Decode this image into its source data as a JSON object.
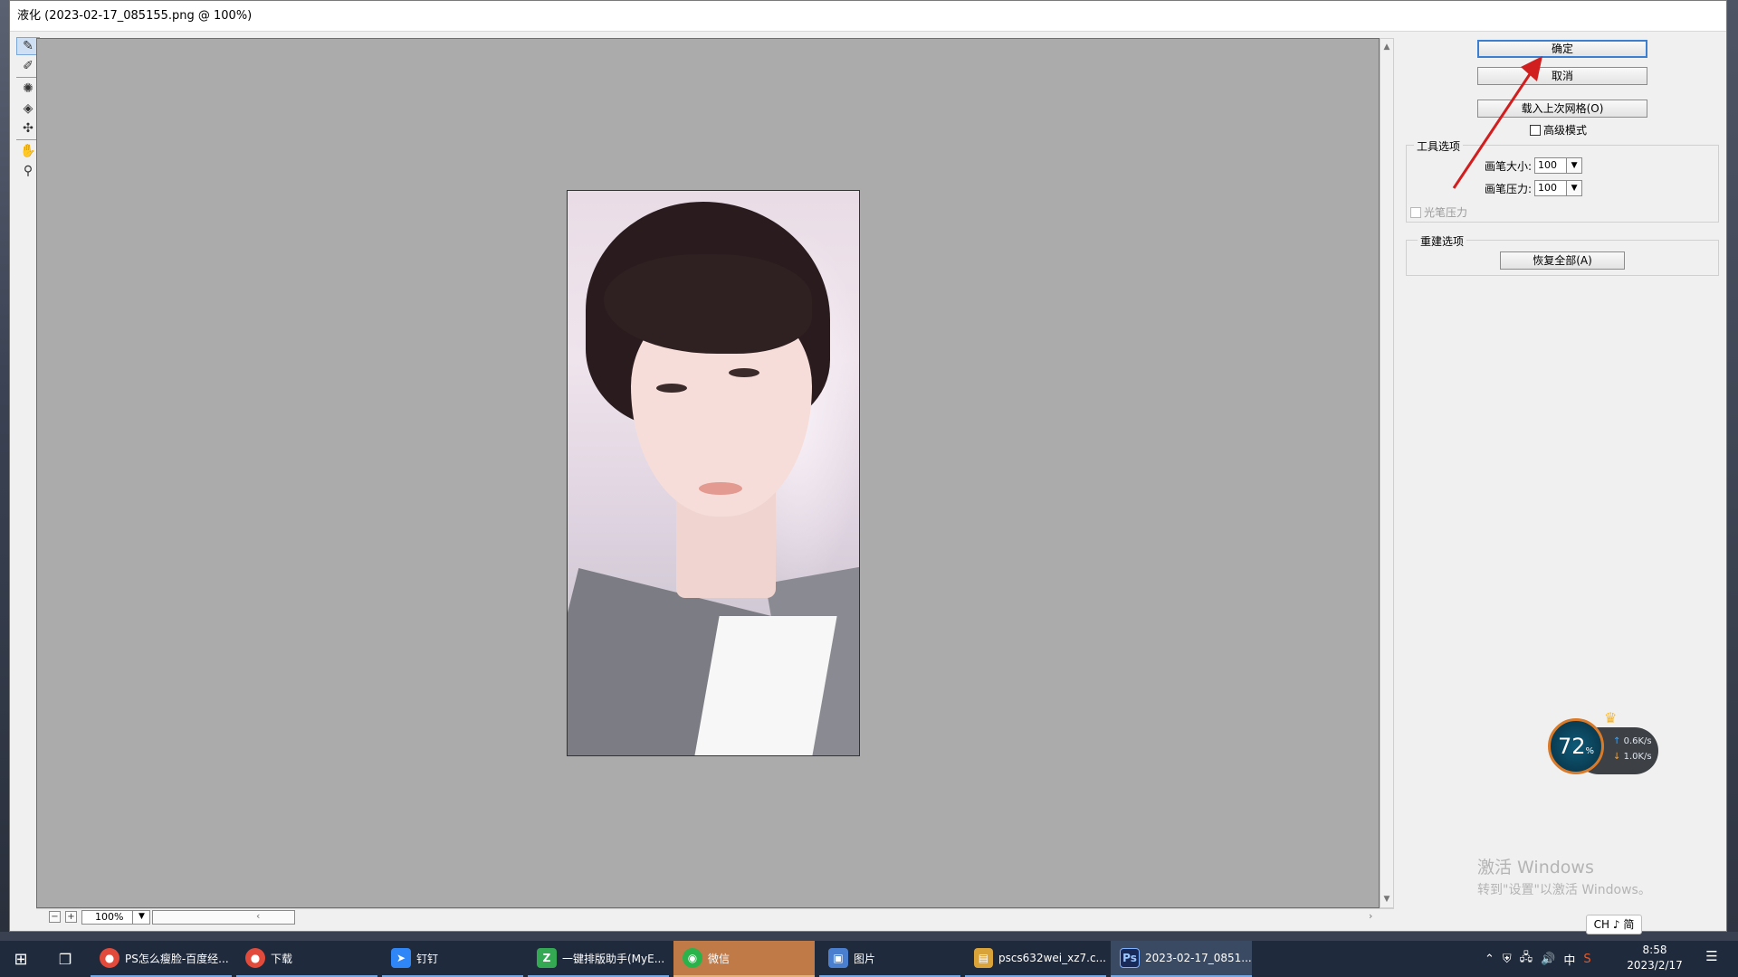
{
  "window": {
    "title": "液化 (2023-02-17_085155.png @ 100%)"
  },
  "tools": [
    {
      "name": "forward-warp-tool",
      "glyph": "✎"
    },
    {
      "name": "reconstruct-tool",
      "glyph": "✐"
    },
    {
      "name": "twirl-tool",
      "glyph": "✺"
    },
    {
      "name": "pucker-tool",
      "glyph": "◈"
    },
    {
      "name": "bloat-tool",
      "glyph": "✣"
    },
    {
      "name": "hand-tool",
      "glyph": "✋"
    },
    {
      "name": "zoom-tool",
      "glyph": "⚲"
    }
  ],
  "canvas": {
    "zoom_value": "100%"
  },
  "panel": {
    "ok_label": "确定",
    "cancel_label": "取消",
    "load_mesh_label": "载入上次网格(O)",
    "advanced_mode_label": "高级模式",
    "tool_options_title": "工具选项",
    "brush_size_label": "画笔大小:",
    "brush_size_value": "100",
    "brush_pressure_label": "画笔压力:",
    "brush_pressure_value": "100",
    "stylus_pressure_label": "光笔压力",
    "reconstruct_title": "重建选项",
    "restore_all_label": "恢复全部(A)"
  },
  "net_widget": {
    "percent": "72",
    "percent_unit": "%",
    "up_speed": "0.6K/s",
    "down_speed": "1.0K/s"
  },
  "watermark": {
    "line1": "激活 Windows",
    "line2": "转到\"设置\"以激活 Windows。"
  },
  "ime_indicator": "CH ♪ 简",
  "taskbar": {
    "items": [
      {
        "label": "PS怎么瘦脸-百度经...",
        "icon_name": "chrome-icon",
        "icon_color": "#e24b3b"
      },
      {
        "label": "下载",
        "icon_name": "chrome-icon",
        "icon_color": "#e24b3b"
      },
      {
        "label": "钉钉",
        "icon_name": "dingtalk-icon",
        "icon_color": "#2f86f6"
      },
      {
        "label": "一键排版助手(MyE...",
        "icon_name": "myeditor-icon",
        "icon_color": "#34a853"
      },
      {
        "label": "微信",
        "icon_name": "wechat-icon",
        "icon_color": "#2ab34a"
      },
      {
        "label": "图片",
        "icon_name": "photos-icon",
        "icon_color": "#4a7fcf"
      },
      {
        "label": "pscs632wei_xz7.c...",
        "icon_name": "archive-icon",
        "icon_color": "#d9a33a"
      },
      {
        "label": "2023-02-17_0851...",
        "icon_name": "photoshop-icon",
        "icon_color": "#1a2a58"
      }
    ],
    "tray": {
      "ime_char": "中",
      "time": "8:58",
      "date": "2023/2/17"
    }
  },
  "colors": {
    "arrow": "#d11f1f",
    "primary_border": "#3c7fd0",
    "canvas_bg": "#ababab"
  }
}
